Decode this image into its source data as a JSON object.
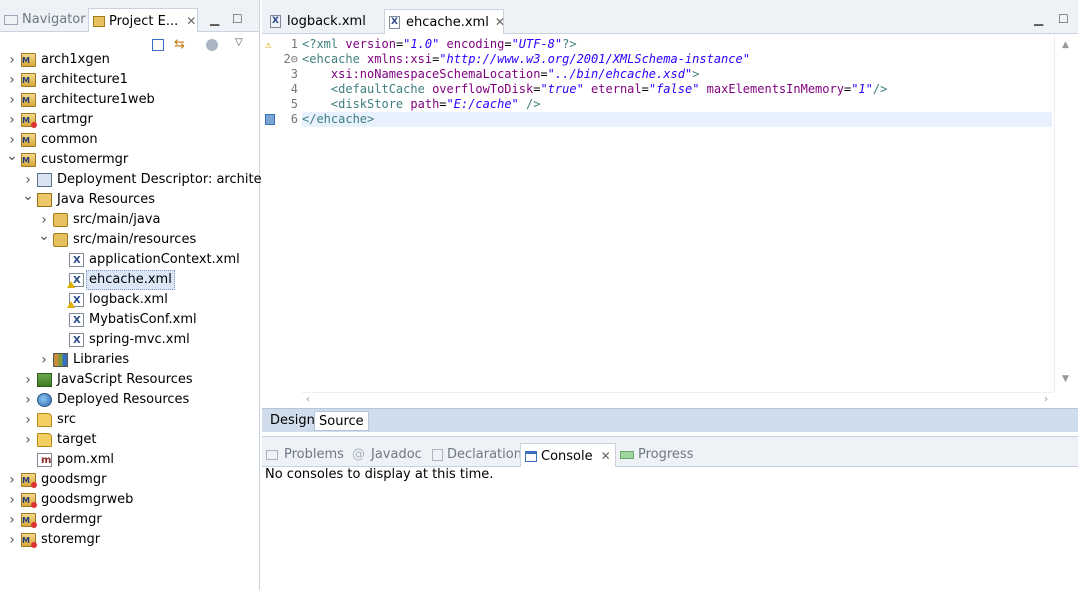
{
  "left_panel": {
    "tabs": [
      {
        "label": "Navigator",
        "icon": "navigator-icon"
      },
      {
        "label": "Project E...",
        "icon": "project-explorer-icon"
      }
    ],
    "tree": [
      {
        "label": "arch1xgen",
        "level": 0,
        "expanded": false,
        "icon": "maven-project-icon"
      },
      {
        "label": "architecture1",
        "level": 0,
        "expanded": false,
        "icon": "maven-project-icon"
      },
      {
        "label": "architecture1web",
        "level": 0,
        "expanded": false,
        "icon": "maven-project-icon"
      },
      {
        "label": "cartmgr",
        "level": 0,
        "expanded": false,
        "icon": "maven-project-error-icon"
      },
      {
        "label": "common",
        "level": 0,
        "expanded": false,
        "icon": "maven-project-icon"
      },
      {
        "label": "customermgr",
        "level": 0,
        "expanded": true,
        "icon": "maven-project-icon"
      },
      {
        "label": "Deployment Descriptor: architectu",
        "level": 1,
        "expanded": false,
        "icon": "deployment-descriptor-icon"
      },
      {
        "label": "Java Resources",
        "level": 1,
        "expanded": true,
        "icon": "java-resources-icon"
      },
      {
        "label": "src/main/java",
        "level": 2,
        "expanded": false,
        "icon": "package-folder-icon"
      },
      {
        "label": "src/main/resources",
        "level": 2,
        "expanded": true,
        "icon": "package-folder-icon"
      },
      {
        "label": "applicationContext.xml",
        "level": 3,
        "leaf": true,
        "icon": "xml-file-icon"
      },
      {
        "label": "ehcache.xml",
        "level": 3,
        "leaf": true,
        "icon": "xml-file-warning-icon",
        "selected": true
      },
      {
        "label": "logback.xml",
        "level": 3,
        "leaf": true,
        "icon": "xml-file-warning-icon"
      },
      {
        "label": "MybatisConf.xml",
        "level": 3,
        "leaf": true,
        "icon": "xml-file-icon"
      },
      {
        "label": "spring-mvc.xml",
        "level": 3,
        "leaf": true,
        "icon": "xml-file-icon"
      },
      {
        "label": "Libraries",
        "level": 2,
        "expanded": false,
        "icon": "libraries-icon"
      },
      {
        "label": "JavaScript Resources",
        "level": 1,
        "expanded": false,
        "icon": "javascript-resources-icon"
      },
      {
        "label": "Deployed Resources",
        "level": 1,
        "expanded": false,
        "icon": "deployed-resources-icon"
      },
      {
        "label": "src",
        "level": 1,
        "expanded": false,
        "icon": "folder-icon"
      },
      {
        "label": "target",
        "level": 1,
        "expanded": false,
        "icon": "folder-icon"
      },
      {
        "label": "pom.xml",
        "level": 1,
        "leaf": true,
        "icon": "pom-file-icon"
      },
      {
        "label": "goodsmgr",
        "level": 0,
        "expanded": false,
        "icon": "maven-project-error-icon"
      },
      {
        "label": "goodsmgrweb",
        "level": 0,
        "expanded": false,
        "icon": "maven-project-error-icon"
      },
      {
        "label": "ordermgr",
        "level": 0,
        "expanded": false,
        "icon": "maven-project-error-icon"
      },
      {
        "label": "storemgr",
        "level": 0,
        "expanded": false,
        "icon": "maven-project-error-icon"
      }
    ]
  },
  "editor": {
    "tabs": [
      {
        "label": "logback.xml",
        "active": false
      },
      {
        "label": "ehcache.xml",
        "active": true
      }
    ],
    "line_numbers": [
      "1",
      "2",
      "3",
      "4",
      "5",
      "6"
    ],
    "code_lines": [
      [
        {
          "t": "<?xml ",
          "c": "tag"
        },
        {
          "t": "version",
          "c": "attr"
        },
        {
          "t": "=",
          "c": "pun"
        },
        {
          "t": "\"1.0\"",
          "c": "str"
        },
        {
          "t": " ",
          "c": "pun"
        },
        {
          "t": "encoding",
          "c": "attr"
        },
        {
          "t": "=",
          "c": "pun"
        },
        {
          "t": "\"UTF-8\"",
          "c": "str"
        },
        {
          "t": "?>",
          "c": "tag"
        }
      ],
      [
        {
          "t": "<ehcache ",
          "c": "tag"
        },
        {
          "t": "xmlns:xsi",
          "c": "attr"
        },
        {
          "t": "=",
          "c": "pun"
        },
        {
          "t": "\"http://www.w3.org/2001/XMLSchema-instance\"",
          "c": "str"
        }
      ],
      [
        {
          "t": "    ",
          "c": "pun"
        },
        {
          "t": "xsi:noNamespaceSchemaLocation",
          "c": "attr"
        },
        {
          "t": "=",
          "c": "pun"
        },
        {
          "t": "\"../bin/ehcache.xsd\"",
          "c": "str"
        },
        {
          "t": ">",
          "c": "tag"
        }
      ],
      [
        {
          "t": "    ",
          "c": "pun"
        },
        {
          "t": "<defaultCache ",
          "c": "tag"
        },
        {
          "t": "overflowToDisk",
          "c": "attr"
        },
        {
          "t": "=",
          "c": "pun"
        },
        {
          "t": "\"true\"",
          "c": "str"
        },
        {
          "t": " ",
          "c": "pun"
        },
        {
          "t": "eternal",
          "c": "attr"
        },
        {
          "t": "=",
          "c": "pun"
        },
        {
          "t": "\"false\"",
          "c": "str"
        },
        {
          "t": " ",
          "c": "pun"
        },
        {
          "t": "maxElementsInMemory",
          "c": "attr"
        },
        {
          "t": "=",
          "c": "pun"
        },
        {
          "t": "\"1\"",
          "c": "str"
        },
        {
          "t": "/>",
          "c": "tag"
        }
      ],
      [
        {
          "t": "    ",
          "c": "pun"
        },
        {
          "t": "<diskStore ",
          "c": "tag"
        },
        {
          "t": "path",
          "c": "attr"
        },
        {
          "t": "=",
          "c": "pun"
        },
        {
          "t": "\"E:/cache\"",
          "c": "str"
        },
        {
          "t": " />",
          "c": "tag"
        }
      ],
      [
        {
          "t": "</ehcache>",
          "c": "tag"
        }
      ]
    ],
    "bottom_tabs": {
      "design": "Design",
      "source": "Source"
    }
  },
  "console_panel": {
    "tabs": [
      {
        "label": "Problems",
        "active": false
      },
      {
        "label": "Javadoc",
        "active": false
      },
      {
        "label": "Declaration",
        "active": false
      },
      {
        "label": "Console",
        "active": true
      },
      {
        "label": "Progress",
        "active": false
      }
    ],
    "message": "No consoles to display at this time."
  }
}
